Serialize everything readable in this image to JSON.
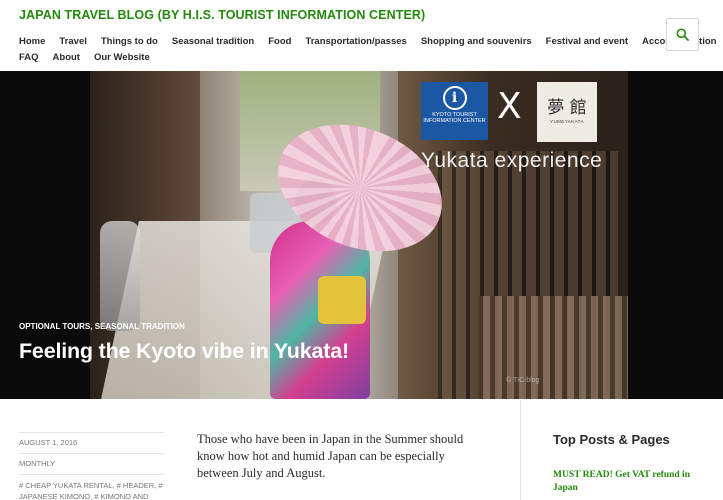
{
  "header": {
    "site_title": "JAPAN TRAVEL BLOG (BY H.I.S. TOURIST INFORMATION CENTER)",
    "nav_row1": [
      "Home",
      "Travel",
      "Things to do",
      "Seasonal tradition",
      "Food",
      "Transportation/passes",
      "Shopping and souvenirs",
      "Festival and event",
      "Accommodation"
    ],
    "nav_row2": [
      "FAQ",
      "About",
      "Our Website"
    ]
  },
  "hero": {
    "logo_kyoto_text": "KYOTO TOURIST INFORMATION CENTER",
    "x_mark": "X",
    "logo_yume_kanji": "夢 館",
    "logo_yume_label": "YUMEYAKATA",
    "overlay_text": "Yukata experience",
    "watermark": "© TIC blog",
    "categories": "OPTIONAL TOURS, SEASONAL TRADITION",
    "post_title": "Feeling the Kyoto vibe in Yukata!"
  },
  "meta": {
    "date": "AUGUST 1, 2016",
    "author": "MONTHLY",
    "tags": "# CHEAP YUKATA RENTAL, # HEADER, # JAPANESE KIMONO, # KIMONO AND YUKATA, # KYOTO, # KYOTO GION, # KYOTO"
  },
  "content": {
    "intro": "Those who have been in Japan in the Summer should know how hot and humid Japan can be especially between July and August."
  },
  "sidebar": {
    "widget_title": "Top Posts & Pages",
    "links": [
      "MUST READ! Get VAT refund in Japan"
    ]
  },
  "colors": {
    "accent": "#24890d",
    "hero_bg": "#0a0a0a",
    "kyoto_blue": "#1c57a4"
  }
}
